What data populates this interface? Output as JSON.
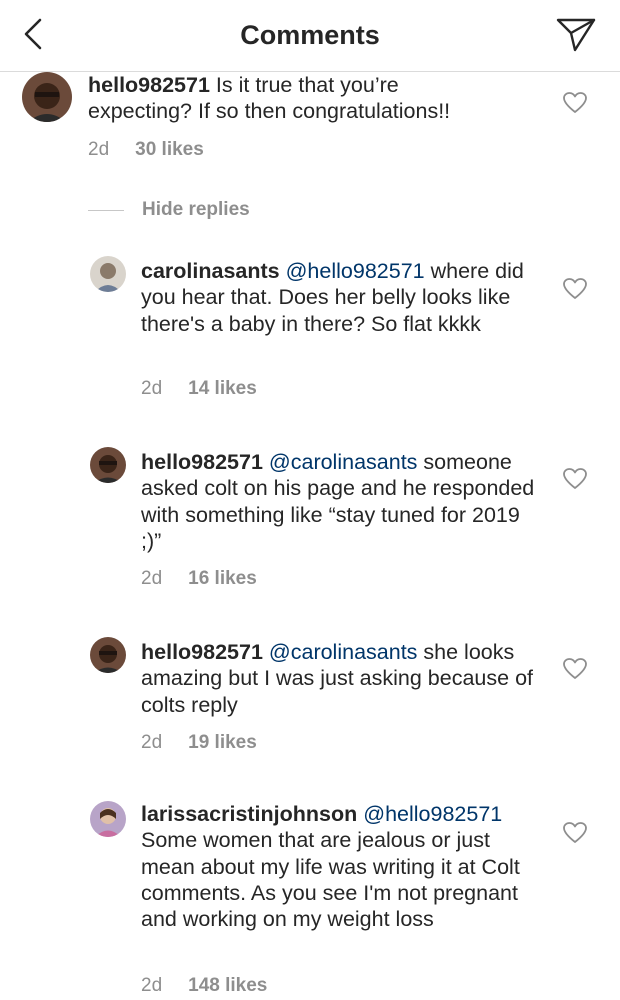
{
  "header": {
    "title": "Comments",
    "back_icon": "chevron-left-icon",
    "send_icon": "direct-send-icon"
  },
  "colors": {
    "text": "#262626",
    "secondary": "#8e8e8e",
    "mention": "#003569",
    "divider": "#dbdbdb"
  },
  "main_comment": {
    "username": "hello982571",
    "text": "Is it true that you’re expecting? If so then congratulations!!",
    "time": "2d",
    "likes": "30 likes"
  },
  "hide_replies_label": "Hide replies",
  "replies": [
    {
      "username": "carolinasants",
      "mention": "@hello982571",
      "text": "where did you hear that. Does her belly looks like there's a baby in there? So flat kkkk",
      "time": "2d",
      "likes": "14 likes"
    },
    {
      "username": "hello982571",
      "mention": "@carolinasants",
      "text": "someone asked colt on his page and he responded with something like “stay tuned for 2019 ;)”",
      "time": "2d",
      "likes": "16 likes"
    },
    {
      "username": "hello982571",
      "mention": "@carolinasants",
      "text": "she looks amazing but I was just asking because of colts reply",
      "time": "2d",
      "likes": "19 likes"
    },
    {
      "username": "larissacristinjohnson",
      "mention": "@hello982571",
      "text": "Some women that are jealous or just mean about my life was writing it at Colt comments. As you see I'm not pregnant and working on my weight loss",
      "time": "2d",
      "likes": "148 likes"
    }
  ]
}
